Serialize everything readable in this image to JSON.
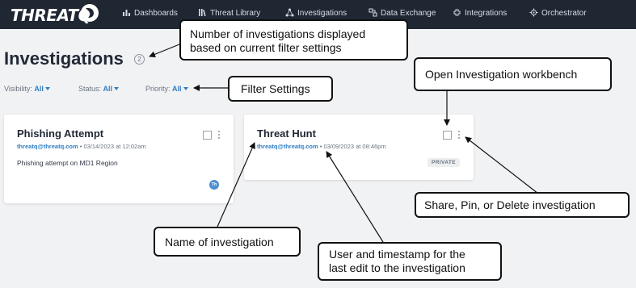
{
  "app": {
    "logo_text": "THREATQ"
  },
  "nav": {
    "items": [
      {
        "label": "Dashboards",
        "icon": "dashboard-icon"
      },
      {
        "label": "Threat Library",
        "icon": "library-icon"
      },
      {
        "label": "Investigations",
        "icon": "investigations-icon"
      },
      {
        "label": "Data Exchange",
        "icon": "data-exchange-icon"
      },
      {
        "label": "Integrations",
        "icon": "integrations-icon"
      },
      {
        "label": "Orchestrator",
        "icon": "orchestrator-icon"
      }
    ]
  },
  "page": {
    "title": "Investigations",
    "count": "2"
  },
  "filters": [
    {
      "label": "Visibility:",
      "value": "All"
    },
    {
      "label": "Status:",
      "value": "All"
    },
    {
      "label": "Priority:",
      "value": "All"
    }
  ],
  "cards": [
    {
      "title": "Phishing Attempt",
      "user": "threatq@threatq.com",
      "timestamp": "• 03/14/2023 at 12:02am",
      "description": "Phishing attempt on MD1 Region",
      "avatar": "Th"
    },
    {
      "title": "Threat Hunt",
      "user": "threatq@threatq.com",
      "timestamp": "• 03/09/2023 at 08:46pm",
      "badge": "PRIVATE"
    }
  ],
  "callouts": {
    "count_line1": "Number of  investigations displayed",
    "count_line2": "based on current filter settings",
    "filters": "Filter Settings",
    "open": "Open Investigation workbench",
    "share": "Share, Pin, or Delete investigation",
    "name": "Name of investigation",
    "user_line1": "User and timestamp for the",
    "user_line2": "last edit to the investigation"
  },
  "colors": {
    "nav_bg": "#1f2733",
    "accent": "#2f7dc4",
    "page_bg": "#f1f2f4"
  }
}
